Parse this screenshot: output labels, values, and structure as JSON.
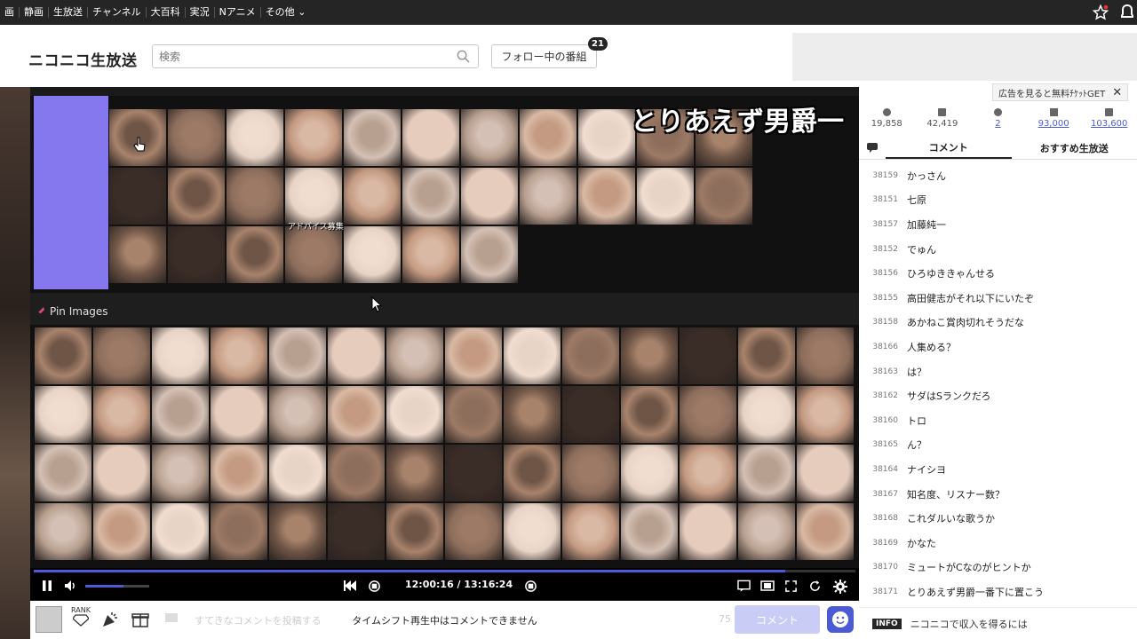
{
  "topnav": {
    "items": [
      "画",
      "静画",
      "生放送",
      "チャンネル",
      "大百科",
      "実況",
      "Nアニメ",
      "その他"
    ]
  },
  "header": {
    "logo": "ニコニコ生放送",
    "search_placeholder": "検索",
    "follow_button": "フォロー中の番組",
    "follow_count": "21"
  },
  "player": {
    "overlay_title": "とりあえず男爵一",
    "pin_label": "Pin Images",
    "advice_text": "アドバイス募集",
    "time": "12:00:16 / 13:16:24",
    "progress_fraction": 0.915,
    "volume_fraction": 0.6
  },
  "bottom": {
    "rank_label": "RANK",
    "comment_placeholder": "すてきなコメントを投稿する",
    "timeshift_message": "タイムシフト再生中はコメントできません",
    "char_count": "75",
    "comment_button": "コメント"
  },
  "side": {
    "ad_text": "広告を見ると無料ﾁｹｯﾄGET",
    "stats": [
      {
        "icon": "viewer-icon",
        "value": "19,858"
      },
      {
        "icon": "comment-count-icon",
        "value": "42,419"
      },
      {
        "icon": "timeshift-icon",
        "value": "2"
      },
      {
        "icon": "ad-point-icon",
        "value": "93,000"
      },
      {
        "icon": "gift-icon",
        "value": "103,600"
      }
    ],
    "tabs": [
      "コメント",
      "おすすめ生放送"
    ],
    "comments": [
      {
        "num": "38159",
        "text": "かっさん"
      },
      {
        "num": "38151",
        "text": "七原"
      },
      {
        "num": "38157",
        "text": "加藤純一"
      },
      {
        "num": "38152",
        "text": "でゅん"
      },
      {
        "num": "38156",
        "text": "ひろゆききゃんせる"
      },
      {
        "num": "38155",
        "text": "高田健志がそれ以下にいたぞ"
      },
      {
        "num": "38158",
        "text": "あかねこ賞肉切れそうだな"
      },
      {
        "num": "38166",
        "text": "人集める？"
      },
      {
        "num": "38163",
        "text": "は？"
      },
      {
        "num": "38162",
        "text": "サダはSランクだろ"
      },
      {
        "num": "38160",
        "text": "トロ"
      },
      {
        "num": "38165",
        "text": "ん？"
      },
      {
        "num": "38164",
        "text": "ナイシヨ"
      },
      {
        "num": "38167",
        "text": "知名度、リスナー数？"
      },
      {
        "num": "38168",
        "text": "これダルいな歌うか"
      },
      {
        "num": "38169",
        "text": "かなた"
      },
      {
        "num": "38170",
        "text": "ミュートがCなのがヒントか"
      },
      {
        "num": "38171",
        "text": "とりあえず男爵一番下に置こう"
      }
    ],
    "info_tag": "INFO",
    "info_text": "ニコニコで収入を得るには"
  },
  "colors": {
    "accent": "#4b5bd6",
    "purple_panel": "#8577ee",
    "topbar": "#252525"
  }
}
